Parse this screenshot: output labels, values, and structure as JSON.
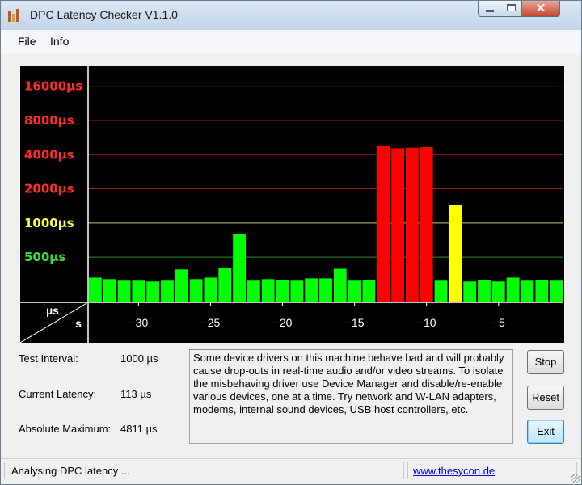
{
  "window": {
    "title": "DPC Latency Checker V1.1.0",
    "close_glyph": "✕"
  },
  "menu": {
    "items": [
      "File",
      "Info"
    ]
  },
  "chart_data": {
    "type": "bar",
    "x_unit_label": "s",
    "y_unit_label": "µs",
    "y_scale": "log",
    "ylim": [
      200,
      24000
    ],
    "x_ticks": [
      -30,
      -25,
      -20,
      -15,
      -10,
      -5
    ],
    "y_ticks": [
      {
        "label": "16000µs",
        "value": 16000,
        "color": "#ff2a2a",
        "grid": "#a11a1a"
      },
      {
        "label": "8000µs",
        "value": 8000,
        "color": "#ff2a2a",
        "grid": "#a11a1a"
      },
      {
        "label": "4000µs",
        "value": 4000,
        "color": "#ff2a2a",
        "grid": "#a11a1a"
      },
      {
        "label": "2000µs",
        "value": 2000,
        "color": "#ff2a2a",
        "grid": "#a11a1a"
      },
      {
        "label": "1000µs",
        "value": 1000,
        "color": "#ffff33",
        "grid": "#c8c870"
      },
      {
        "label": "500µs",
        "value": 500,
        "color": "#33dd33",
        "grid": "#2f8f2f"
      }
    ],
    "bars": [
      {
        "x": -33,
        "value": 330,
        "color": "#00ff00"
      },
      {
        "x": -32,
        "value": 320,
        "color": "#00ff00"
      },
      {
        "x": -31,
        "value": 310,
        "color": "#00ff00"
      },
      {
        "x": -30,
        "value": 310,
        "color": "#00ff00"
      },
      {
        "x": -29,
        "value": 305,
        "color": "#00ff00"
      },
      {
        "x": -28,
        "value": 310,
        "color": "#00ff00"
      },
      {
        "x": -27,
        "value": 390,
        "color": "#00ff00"
      },
      {
        "x": -26,
        "value": 320,
        "color": "#00ff00"
      },
      {
        "x": -25,
        "value": 330,
        "color": "#00ff00"
      },
      {
        "x": -24,
        "value": 400,
        "color": "#00ff00"
      },
      {
        "x": -23,
        "value": 800,
        "color": "#00ff00"
      },
      {
        "x": -22,
        "value": 310,
        "color": "#00ff00"
      },
      {
        "x": -21,
        "value": 320,
        "color": "#00ff00"
      },
      {
        "x": -20,
        "value": 315,
        "color": "#00ff00"
      },
      {
        "x": -19,
        "value": 310,
        "color": "#00ff00"
      },
      {
        "x": -18,
        "value": 325,
        "color": "#00ff00"
      },
      {
        "x": -17,
        "value": 325,
        "color": "#00ff00"
      },
      {
        "x": -16,
        "value": 395,
        "color": "#00ff00"
      },
      {
        "x": -15,
        "value": 310,
        "color": "#00ff00"
      },
      {
        "x": -14,
        "value": 315,
        "color": "#00ff00"
      },
      {
        "x": -13,
        "value": 4800,
        "color": "#ff0000"
      },
      {
        "x": -12,
        "value": 4550,
        "color": "#ff0000"
      },
      {
        "x": -11,
        "value": 4600,
        "color": "#ff0000"
      },
      {
        "x": -10,
        "value": 4650,
        "color": "#ff0000"
      },
      {
        "x": -9,
        "value": 310,
        "color": "#00ff00"
      },
      {
        "x": -8,
        "value": 1450,
        "color": "#ffff00"
      },
      {
        "x": -7,
        "value": 305,
        "color": "#00ff00"
      },
      {
        "x": -6,
        "value": 315,
        "color": "#00ff00"
      },
      {
        "x": -5,
        "value": 305,
        "color": "#00ff00"
      },
      {
        "x": -4,
        "value": 330,
        "color": "#00ff00"
      },
      {
        "x": -3,
        "value": 310,
        "color": "#00ff00"
      },
      {
        "x": -2,
        "value": 315,
        "color": "#00ff00"
      },
      {
        "x": -1,
        "value": 310,
        "color": "#00ff00"
      }
    ]
  },
  "stats": {
    "test_interval_label": "Test Interval:",
    "test_interval_value": "1000 µs",
    "current_latency_label": "Current Latency:",
    "current_latency_value": "113 µs",
    "absolute_maximum_label": "Absolute Maximum:",
    "absolute_maximum_value": "4811 µs"
  },
  "message": "Some device drivers on this machine behave bad and will probably cause drop-outs in real-time audio and/or video streams. To isolate the misbehaving driver use Device Manager and disable/re-enable various devices, one at a time. Try network and W-LAN adapters, modems, internal sound devices, USB host controllers, etc.",
  "buttons": {
    "stop": "Stop",
    "reset": "Reset",
    "exit": "Exit"
  },
  "status": {
    "text": "Analysing DPC latency ...",
    "link": "www.thesycon.de"
  }
}
